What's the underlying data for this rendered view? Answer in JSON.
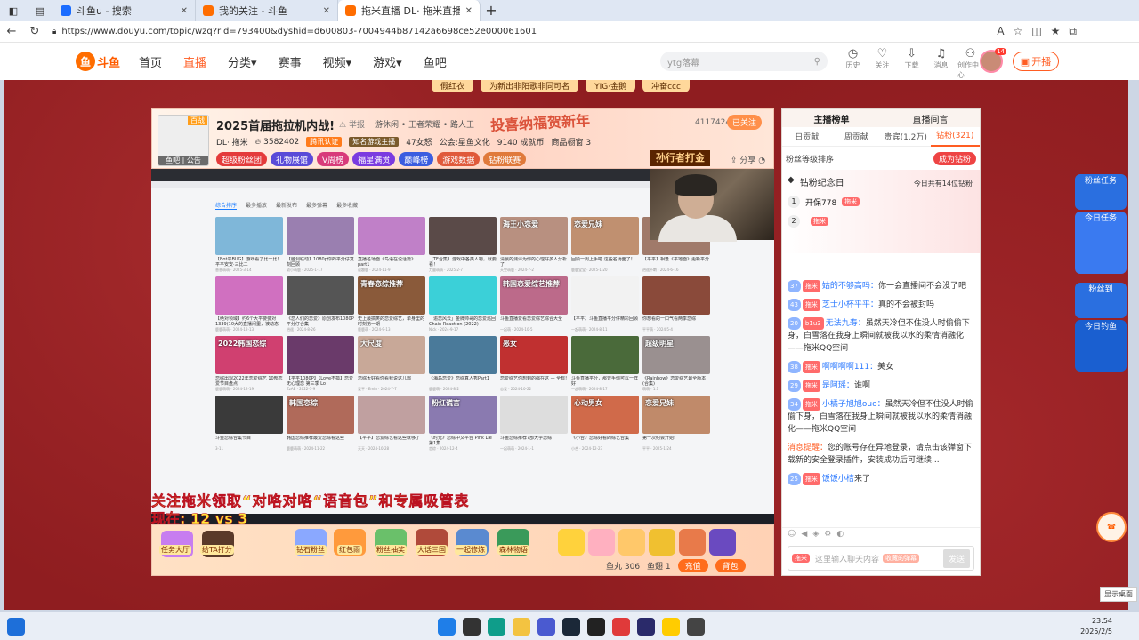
{
  "browser": {
    "tabs": [
      {
        "label": "斗鱼u - 搜索",
        "fav": "#1a6cff"
      },
      {
        "label": "我的关注 - 斗鱼",
        "fav": "#ff6d00"
      },
      {
        "label": "拖米直播 DL· 拖米直播 拖米王·",
        "fav": "#ff6d00"
      }
    ],
    "url": "https://www.douyu.com/topic/wzq?rid=793400&dyshid=d600803-7004944b87142a6698ce52e000061601"
  },
  "site": {
    "logo_text": "斗鱼",
    "nav": [
      "首页",
      "直播",
      "分类",
      "赛事",
      "视频",
      "游戏",
      "鱼吧"
    ],
    "search_placeholder": "ytg落幕",
    "tools": [
      {
        "icon": "history-icon",
        "label": "历史"
      },
      {
        "icon": "heart-icon",
        "label": "关注"
      },
      {
        "icon": "download-icon",
        "label": "下载"
      },
      {
        "icon": "bell-icon",
        "label": "消息"
      },
      {
        "icon": "creator-icon",
        "label": "创作中心"
      }
    ],
    "avatar_badge": "14",
    "kaibo": "开播"
  },
  "banner": [
    "假红衣",
    "为新出非阳歌非同可名",
    "YIG·金鹅",
    "冲奋ccc"
  ],
  "room": {
    "avatar_tag": "百战",
    "avatar_caption": "鱼吧 | 公告",
    "title": "2025首届拖拉机内战!",
    "report": "举报",
    "categories": "游休闲 • 王者荣耀 • 路人王",
    "streamer": "DL· 拖米",
    "hot": "3582402",
    "badge": "腾讯认证",
    "known": "知名游戏主播",
    "level": "47女怒",
    "guild": "公会:星鱼文化",
    "fans": "9140 成就币",
    "items": "商品橱窗 3",
    "view_count": "4117424",
    "follow": "已关注",
    "fest": "投喜纳福贺新年",
    "rank_banner": "孙行者打金",
    "share": "分享",
    "buttons": [
      {
        "label": "超级粉丝团",
        "color": "#e43b3b"
      },
      {
        "label": "礼物展馆",
        "color": "#5a4bd8"
      },
      {
        "label": "V周榜",
        "color": "#d83b7a"
      },
      {
        "label": "福星满贯",
        "color": "#7b3be0"
      },
      {
        "label": "巅峰榜",
        "color": "#3b5de0"
      },
      {
        "label": "游戏数据",
        "color": "#e05a3b"
      },
      {
        "label": "钻粉联赛",
        "color": "#e07a3b"
      }
    ]
  },
  "video": {
    "tabs": [
      "综合排序",
      "最多播放",
      "最新发布",
      "最多弹幕",
      "最多收藏"
    ],
    "cards": [
      {
        "t": "【Bot平BUG】游戏看了比一比！平平安安·三比二",
        "m": "香香萌萌 · 2025-3-14",
        "c": "#7fb7d9",
        "o": ""
      },
      {
        "t": "【脑洞联动】1080p你的平分仔复刻回顾",
        "m": "幼小萌鹿 · 2025-1-17",
        "c": "#9a7fb0",
        "o": ""
      },
      {
        "t": "直播名场面《鸟语在说话篇》part1",
        "m": "逗趣鹿 · 2024-11-9",
        "c": "#c080c8",
        "o": ""
      },
      {
        "t": "【TF合集】游戏中各类人物，就要看！",
        "m": "力量萌萌 · 2025-2-7",
        "c": "#5a4a48",
        "o": ""
      },
      {
        "t": "清晨的测评为你的心理好多人分析了",
        "m": "天空萌鹿 · 2024-7-2",
        "c": "#b89080",
        "o": "海王小恋爱"
      },
      {
        "t": "回顾一周上手吧 这些名场面了！",
        "m": "鹿鹿宝宝 · 2025-1-20",
        "c": "#c09070",
        "o": "恋爱兄妹"
      },
      {
        "t": "【平平】相逢《平地面》更新平分",
        "m": "逍遥不羁 · 2024-6-16",
        "c": "#a07a6a",
        "o": ""
      },
      {
        "t": "【绝对领域】约6个大平要要对1339(10大的直播间里，被动态",
        "m": "鹿鹿萌萌 · 2024-12-13",
        "c": "#d070c0",
        "o": ""
      },
      {
        "t": "《恋人们的恋爱》原创发布1080P 平分仔合集",
        "m": "逍遥 · 2024-8-26",
        "c": "#555",
        "o": ""
      },
      {
        "t": "史上最搞笑的恋爱综艺，单身里的时刻第一期",
        "m": "鹿鹿萌 · 2024-9-13",
        "c": "#8a5a3a",
        "o": "青春恋综推荐"
      },
      {
        "t": "「追恋风云」金牌帅哥的恋爱巡回 Chain Reaction (2022)",
        "m": "Nick · 2024-9-17",
        "c": "#3bd0d8",
        "o": ""
      },
      {
        "t": "斗鱼直播爱看恋爱综艺综合大全",
        "m": "一起萌 · 2024-10-5",
        "c": "#bc6a8a",
        "o": "韩国恋爱综艺推荐"
      },
      {
        "t": "【平平】斗鱼直播平分仔精彩回顾",
        "m": "一起萌萌 · 2024-8-11",
        "c": "#f2f2f2",
        "o": ""
      },
      {
        "t": "你想看的一口气看两季恋综",
        "m": "平平萌 · 2024-5-4",
        "c": "#8a4a3a",
        "o": ""
      },
      {
        "t": "恋综出现2022年恋爱综艺 10部恋爱节目盘点",
        "m": "鹿鹿萌萌 · 2024-12-19",
        "c": "#d04070",
        "o": "2022韩国恋综"
      },
      {
        "t": "【平平1080P】【Love不孤】恋爱无心理恋 第三季 Lo",
        "m": "ZzAB · 2022-7-9",
        "c": "#6a3a6a",
        "o": ""
      },
      {
        "t": "恋综太好看你看我说这几部",
        "m": "爱平 · Emin · 2024-7-7",
        "c": "#c8a898",
        "o": "大尺度"
      },
      {
        "t": "《海岛恋爱》恋综真人秀Part1",
        "m": "鹿鹿萌 · 2024-8-2",
        "c": "#4a7a9a",
        "o": ""
      },
      {
        "t": "恋爱综艺你想到的都在这 — 全有!",
        "m": "恋爱 · 2024-10-22",
        "c": "#c03030",
        "o": "恶女"
      },
      {
        "t": "斗鱼直播平分，那曾手你可以一样好",
        "m": "一起萌萌 · 2024-8-17",
        "c": "#4a6a3a",
        "o": ""
      },
      {
        "t": "《Rainbow》恋爱综艺最全版本 (合集)",
        "m": "萌萌 · 1.1",
        "c": "#9a9090",
        "o": "超级明星"
      },
      {
        "t": "斗鱼恋综合集节目",
        "m": "3-11",
        "c": "#3a3a3a",
        "o": ""
      },
      {
        "t": "韩国恋综推荐最爱恋综看这些",
        "m": "鹿鹿萌萌 · 2024-11-22",
        "c": "#b06a5a",
        "o": "韩国恋综"
      },
      {
        "t": "【平平】恋爱综艺看这些就够了",
        "m": "天天 · 2024-10-28",
        "c": "#c0a0a0",
        "o": ""
      },
      {
        "t": "《时光》恋综中文平台 Pink Lie 第1集",
        "m": "恋综 · 2024-12-4",
        "c": "#8a7ab0",
        "o": "粉红谎言"
      },
      {
        "t": "斗鱼恋综推荐7部大学恋综",
        "m": "一起萌萌 · 2024-1-1",
        "c": "#ddd",
        "o": ""
      },
      {
        "t": "《小合》恋综好看的综艺合集",
        "m": "小合 · 2024-12-23",
        "c": "#d06a4a",
        "o": "心动男女"
      },
      {
        "t": "第一次约会开始!",
        "m": "平平 · 2025-1-24",
        "c": "#c08a6a",
        "o": "恋爱兄妹"
      }
    ],
    "overlay1": "关注拖米领取“对咯对咯“语音包”和专属吸管表",
    "overlay2": "现在: 12 vs 3"
  },
  "gifts": {
    "labels": [
      "钻石粉丝",
      "红包雨",
      "粉丝抽奖",
      "大话三国",
      "一起修炼",
      "森林物语"
    ],
    "left1": "任务大厅",
    "left2": "给TA打分",
    "fish_balls": "鱼丸 306",
    "fish_wings": "鱼翅 1",
    "btn_charge": "充值",
    "btn_pack": "背包"
  },
  "side": {
    "tabs": [
      "主播榜单",
      "直播间言"
    ],
    "rank_tabs": [
      "日贡献",
      "周贡献",
      "贵宾(1.2万)",
      "钻粉(321)"
    ],
    "fans_text": "粉丝等级排序",
    "buy": "成为钻粉",
    "diamond_title": "钻粉纪念日",
    "diamond_sub": "今日共有14位钻粉",
    "diamond_rows": [
      {
        "n": "1",
        "name": "开保778",
        "tag": "拖米"
      },
      {
        "n": "2",
        "name": "",
        "tag": "拖米"
      }
    ],
    "messages": [
      {
        "lv": "37",
        "fb": "拖米",
        "user": "姑的不够高吗：",
        "text": "你一会直播间不会没了吧"
      },
      {
        "lv": "43",
        "fb": "拖米",
        "user": "芝士小杯平平：",
        "text": "真的不会被封吗"
      },
      {
        "lv": "20",
        "fb": "b1u3",
        "user": "无法九寿：",
        "text": "虽然天冷但不住没人时偷偷下身，白雪落在我身上瞬间就被我以水的柔情消融化——拖米QQ空间"
      },
      {
        "lv": "38",
        "fb": "拖米",
        "user": "啊啊啊啊111：",
        "text": "美女"
      },
      {
        "lv": "29",
        "fb": "拖米",
        "user": "是阿瑶：",
        "text": "谁啊"
      },
      {
        "lv": "34",
        "fb": "拖米",
        "user": "小橘子旭旭ouo：",
        "text": "虽然天冷但不住没人时偷偷下身，白雪落在我身上瞬间就被我以水的柔情消融化——拖米QQ空间"
      },
      {
        "lv": "",
        "fb": "",
        "user": "消息提醒：",
        "text": "您的账号存在异地登录，请点击该弹窗下载新的安全登录插件，安装成功后可继续..."
      },
      {
        "lv": "25",
        "fb": "拖米",
        "user": "饭饭小桔",
        "text": "来了"
      }
    ],
    "input_placeholder": "这里输入聊天内容",
    "input_tag": "拖米",
    "input_btn": "收藏的弹幕",
    "send": "发送"
  },
  "floats": [
    "粉丝任务",
    "今日任务",
    "粉丝到",
    "今日钓鱼"
  ],
  "desktop": {
    "show": "显示桌面",
    "time": "23:54",
    "date": "2025/2/5"
  }
}
